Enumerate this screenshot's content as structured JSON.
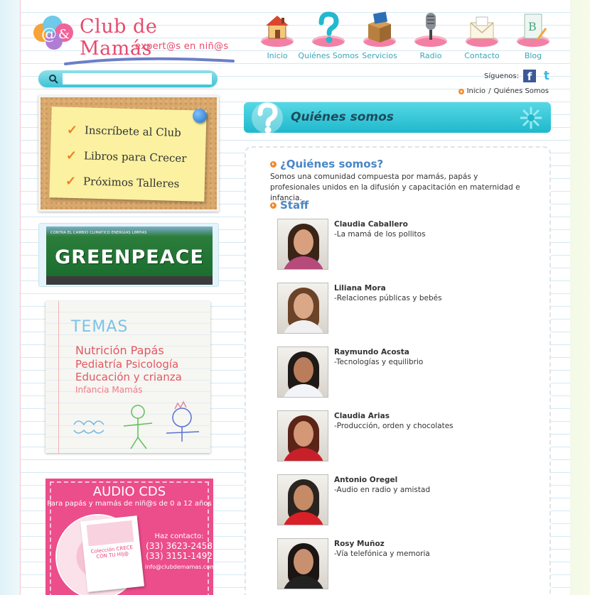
{
  "brand": {
    "name": "Club de Mamás",
    "tagline": "expert@s en niñ@s"
  },
  "nav": [
    {
      "label": "Inicio",
      "icon": "house-icon"
    },
    {
      "label": "Quiénes Somos",
      "icon": "question-mark-icon"
    },
    {
      "label": "Servicios",
      "icon": "box-icon"
    },
    {
      "label": "Radio",
      "icon": "microphone-icon"
    },
    {
      "label": "Contacto",
      "icon": "envelope-icon"
    },
    {
      "label": "Blog",
      "icon": "blog-notebook-icon"
    }
  ],
  "search": {
    "placeholder": "",
    "value": ""
  },
  "social": {
    "label": "Síguenos:",
    "facebook": "f",
    "twitter": "t"
  },
  "breadcrumb": {
    "home": "Inicio",
    "separator": "/",
    "current": "Quiénes Somos"
  },
  "sidebar": {
    "note_items": [
      "Inscríbete al Club",
      "Libros para Crecer",
      "Próximos Talleres"
    ],
    "greenpeace": {
      "banner_text": "CONTRA EL CAMBIO CLIMÁTICO ENERGÍAS LIMPIAS",
      "word": "GREENPEACE"
    },
    "temas": {
      "title": "TEMAS",
      "lines": [
        "Nutrición Papás",
        "Pediatría Psicología",
        "Educación y crianza",
        "Infancia Mamás"
      ]
    },
    "audio": {
      "title": "AUDIO CDS",
      "subtitle": "Para papás y mamás de niñ@s de 0 a 12 años",
      "cd_text": "Colección CRECE CON TU HIJ@",
      "contact_label": "Haz contacto:",
      "phone1": "(33) 3623-2458",
      "phone2": "(33) 3151-1492",
      "email": "info@clubdemamas.com"
    }
  },
  "page_banner": {
    "title": "Quiénes somos"
  },
  "about": {
    "title": "¿Quiénes somos?",
    "text": "Somos una comunidad compuesta por mamás, papás y profesionales unidos en la difusión y capacitación en maternidad e infancia."
  },
  "staff": {
    "title": "Staff",
    "members": [
      {
        "name": "Claudia Caballero",
        "role": "-La mamá de los pollitos",
        "hair": "#3a2418",
        "body": "#b64a7a",
        "skin": "#d9a07f"
      },
      {
        "name": "Liliana Mora",
        "role": "-Relaciones públicas y bebés",
        "hair": "#6b4328",
        "body": "#f0f0f0",
        "skin": "#dba887"
      },
      {
        "name": "Raymundo Acosta",
        "role": "-Tecnologías y equilibrio",
        "hair": "#1f1a17",
        "body": "#f2f4f7",
        "skin": "#b97d5b"
      },
      {
        "name": "Claudia Arias",
        "role": "-Producción, orden y chocolates",
        "hair": "#5a2418",
        "body": "#c8202a",
        "skin": "#d49877"
      },
      {
        "name": "Antonio Oregel",
        "role": "-Audio en radio y amistad",
        "hair": "#2a2420",
        "body": "#d82026",
        "skin": "#c58a66"
      },
      {
        "name": "Rosy Muñoz",
        "role": "-Vía telefónica y memoria",
        "hair": "#1b1513",
        "body": "#222222",
        "skin": "#c99070"
      }
    ]
  },
  "colors": {
    "brand_pink": "#e84a6c",
    "nav_teal": "#3aa6b8",
    "accent_cyan": "#1fb8cc",
    "heading_blue": "#4a86c5",
    "bullet_orange": "#f28a2c"
  }
}
